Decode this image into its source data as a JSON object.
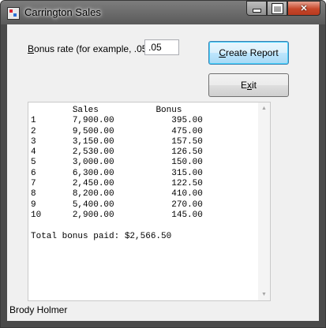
{
  "window": {
    "title": "Carrington Sales"
  },
  "form": {
    "bonus_label_accel": "B",
    "bonus_label_rest": "onus rate (for example, .05):",
    "bonus_rate_value": ".05",
    "create_accel": "C",
    "create_rest": "reate Report",
    "exit_pre": "E",
    "exit_accel": "x",
    "exit_rest": "it"
  },
  "report": {
    "header_sales": "Sales",
    "header_bonus": "Bonus",
    "rows": [
      {
        "num": "1",
        "sales": "7,900.00",
        "bonus": "395.00"
      },
      {
        "num": "2",
        "sales": "9,500.00",
        "bonus": "475.00"
      },
      {
        "num": "3",
        "sales": "3,150.00",
        "bonus": "157.50"
      },
      {
        "num": "4",
        "sales": "2,530.00",
        "bonus": "126.50"
      },
      {
        "num": "5",
        "sales": "3,000.00",
        "bonus": "150.00"
      },
      {
        "num": "6",
        "sales": "6,300.00",
        "bonus": "315.00"
      },
      {
        "num": "7",
        "sales": "2,450.00",
        "bonus": "122.50"
      },
      {
        "num": "8",
        "sales": "8,200.00",
        "bonus": "410.00"
      },
      {
        "num": "9",
        "sales": "5,400.00",
        "bonus": "270.00"
      },
      {
        "num": "10",
        "sales": "2,900.00",
        "bonus": "145.00"
      }
    ],
    "total": "Total bonus paid: $2,566.50"
  },
  "footer": {
    "author": "Brody Holmer"
  },
  "icons": {
    "minimize": "minimize-icon",
    "maximize": "maximize-icon",
    "close": "close-icon",
    "scroll_up": "scroll-up-arrow-icon",
    "scroll_down": "scroll-down-arrow-icon"
  },
  "colors": {
    "default_button_border": "#3c7fb1",
    "close_button": "#c7472a"
  }
}
